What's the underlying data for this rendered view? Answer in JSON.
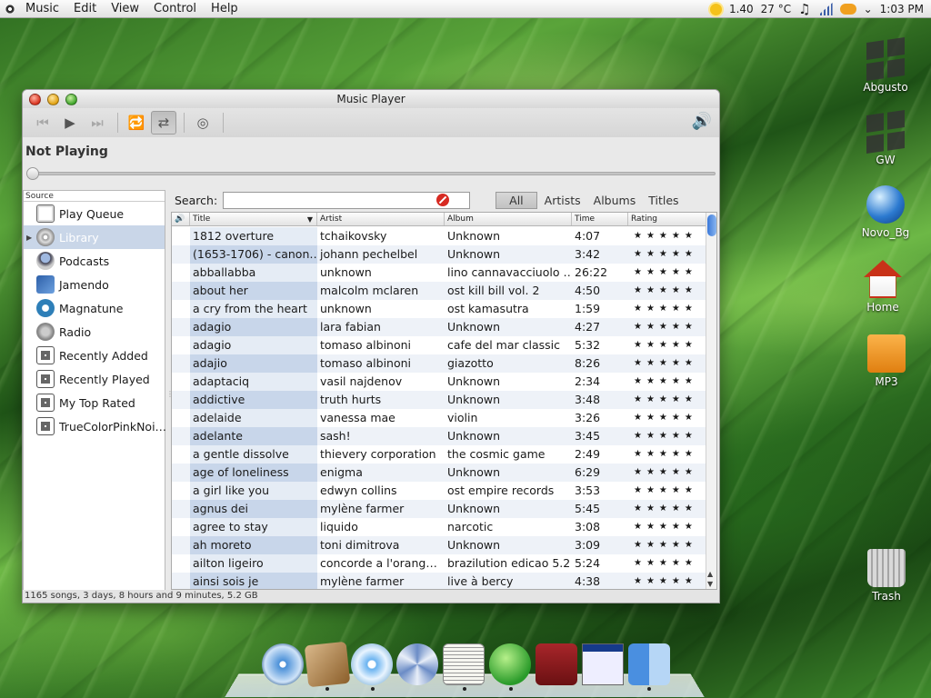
{
  "menubar": {
    "menus": [
      "Music",
      "Edit",
      "View",
      "Control",
      "Help"
    ],
    "cpu_load": "1.40",
    "weather": "27 °C",
    "clock": "1:03 PM"
  },
  "window": {
    "title": "Music Player",
    "now_playing": "Not Playing",
    "status": "1165 songs, 3 days, 8 hours and 9 minutes, 5.2 GB"
  },
  "sources": {
    "header": "Source",
    "items": [
      {
        "label": "Play Queue",
        "icon": "play-queue-icon"
      },
      {
        "label": "Library",
        "icon": "library-icon"
      },
      {
        "label": "Podcasts",
        "icon": "podcast-icon"
      },
      {
        "label": "Jamendo",
        "icon": "jamendo-icon"
      },
      {
        "label": "Magnatune",
        "icon": "magnatune-icon"
      },
      {
        "label": "Radio",
        "icon": "radio-icon"
      },
      {
        "label": "Recently Added",
        "icon": "playlist-icon"
      },
      {
        "label": "Recently Played",
        "icon": "playlist-icon"
      },
      {
        "label": "My Top Rated",
        "icon": "playlist-icon"
      },
      {
        "label": "TrueColorPinkNoi…",
        "icon": "playlist-icon"
      }
    ]
  },
  "search": {
    "label": "Search:",
    "value": ""
  },
  "filters": [
    "All",
    "Artists",
    "Albums",
    "Titles"
  ],
  "columns": {
    "title": "Title",
    "artist": "Artist",
    "album": "Album",
    "time": "Time",
    "rating": "Rating"
  },
  "rating_stars": "★★★★★",
  "tracks": [
    {
      "title": "1812 overture",
      "artist": "tchaikovsky",
      "album": "Unknown",
      "time": "4:07"
    },
    {
      "title": "(1653-1706) - canon…",
      "artist": "johann pechelbel",
      "album": "Unknown",
      "time": "3:42"
    },
    {
      "title": "abballabba",
      "artist": "unknown",
      "album": "lino cannavacciuolo …",
      "time": "26:22"
    },
    {
      "title": "about her",
      "artist": "malcolm mclaren",
      "album": "ost kill bill vol. 2",
      "time": "4:50"
    },
    {
      "title": "a cry from the heart",
      "artist": "unknown",
      "album": "ost kamasutra",
      "time": "1:59"
    },
    {
      "title": "adagio",
      "artist": "lara fabian",
      "album": "Unknown",
      "time": "4:27"
    },
    {
      "title": "adagio",
      "artist": "tomaso albinoni",
      "album": "cafe del mar classic",
      "time": "5:32"
    },
    {
      "title": "adajio",
      "artist": "tomaso albinoni",
      "album": "giazotto",
      "time": "8:26"
    },
    {
      "title": "adaptaciq",
      "artist": "vasil najdenov",
      "album": "Unknown",
      "time": "2:34"
    },
    {
      "title": "addictive",
      "artist": "truth hurts",
      "album": "Unknown",
      "time": "3:48"
    },
    {
      "title": "adelaide",
      "artist": "vanessa mae",
      "album": "violin",
      "time": "3:26"
    },
    {
      "title": "adelante",
      "artist": "sash!",
      "album": "Unknown",
      "time": "3:45"
    },
    {
      "title": "a gentle dissolve",
      "artist": "thievery corporation",
      "album": "the cosmic game",
      "time": "2:49"
    },
    {
      "title": "age of loneliness",
      "artist": "enigma",
      "album": "Unknown",
      "time": "6:29"
    },
    {
      "title": "a girl like you",
      "artist": "edwyn collins",
      "album": "ost empire records",
      "time": "3:53"
    },
    {
      "title": "agnus dei",
      "artist": "mylène farmer",
      "album": "Unknown",
      "time": "5:45"
    },
    {
      "title": "agree to stay",
      "artist": "liquido",
      "album": "narcotic",
      "time": "3:08"
    },
    {
      "title": "ah moreto",
      "artist": "toni dimitrova",
      "album": "Unknown",
      "time": "3:09"
    },
    {
      "title": "ailton ligeiro",
      "artist": "concorde a l'orang…",
      "album": "brazilution edicao 5.2",
      "time": "5:24"
    },
    {
      "title": "ainsi sois je",
      "artist": "mylène farmer",
      "album": "live à bercy",
      "time": "4:38"
    }
  ],
  "desktop_icons": [
    "Abgusto",
    "GW",
    "Novo_Bg",
    "Home",
    "MP3",
    "Trash"
  ]
}
